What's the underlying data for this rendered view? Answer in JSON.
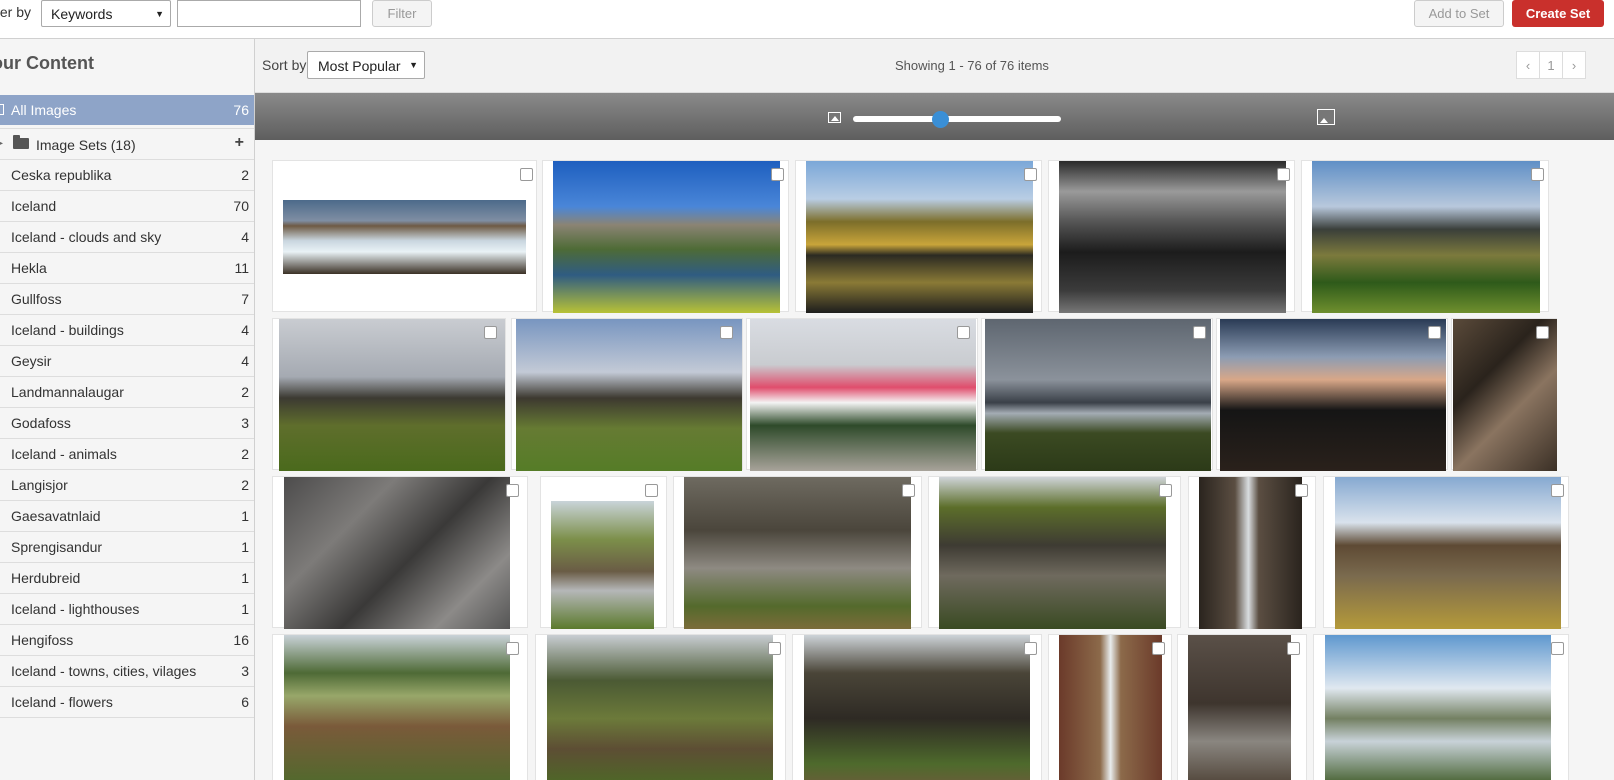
{
  "toolbar": {
    "filter_by_label": "ter by",
    "filter_field_value": "Keywords",
    "filter_input_value": "",
    "filter_button": "Filter",
    "add_to_set_button": "Add to Set",
    "create_set_button": "Create Set",
    "colors": {
      "create_set": "#c9302c"
    }
  },
  "sidebar": {
    "title": "our Content",
    "all_images": {
      "label": "All Images",
      "count": "76"
    },
    "image_sets": {
      "label": "Image Sets (18)",
      "add_icon": "plus-icon"
    },
    "sets": [
      {
        "label": "Ceska republika",
        "count": "2"
      },
      {
        "label": "Iceland",
        "count": "70"
      },
      {
        "label": "Iceland - clouds and sky",
        "count": "4"
      },
      {
        "label": "Hekla",
        "count": "11"
      },
      {
        "label": "Gullfoss",
        "count": "7"
      },
      {
        "label": "Iceland - buildings",
        "count": "4"
      },
      {
        "label": "Geysir",
        "count": "4"
      },
      {
        "label": "Landmannalaugar",
        "count": "2"
      },
      {
        "label": "Godafoss",
        "count": "3"
      },
      {
        "label": "Iceland - animals",
        "count": "2"
      },
      {
        "label": "Langisjor",
        "count": "2"
      },
      {
        "label": "Gaesavatnlaid",
        "count": "1"
      },
      {
        "label": "Sprengisandur",
        "count": "1"
      },
      {
        "label": "Herdubreid",
        "count": "1"
      },
      {
        "label": "Iceland - lighthouses",
        "count": "1"
      },
      {
        "label": "Hengifoss",
        "count": "16"
      },
      {
        "label": "Iceland - towns, cities, vilages",
        "count": "3"
      },
      {
        "label": "Iceland - flowers",
        "count": "6"
      }
    ],
    "colors": {
      "selected": "#8ea4c8"
    }
  },
  "main": {
    "sort_label": "Sort by:",
    "sort_value": "Most Popular",
    "showing_text": "Showing 1 - 76 of 76 items",
    "pager": {
      "prev": "‹",
      "page": "1",
      "next": "›"
    },
    "zoom_level": 0.42,
    "zoom_icons": {
      "small": "image-small-icon",
      "large": "image-large-icon"
    },
    "colors": {
      "slider_thumb": "#3a8fd6"
    }
  }
}
